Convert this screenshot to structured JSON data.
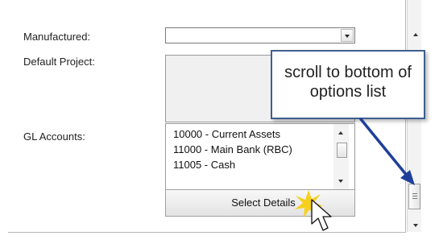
{
  "form": {
    "manufactured_label": "Manufactured:",
    "manufactured_value": "",
    "default_project_label": "Default Project:",
    "gl_accounts_label": "GL Accounts:",
    "gl_accounts": [
      "10000 - Current Assets",
      "11000 - Main Bank (RBC)",
      "11005 - Cash"
    ],
    "select_details_label": "Select Details"
  },
  "callout": {
    "line1": "scroll to bottom of",
    "line2": "options list"
  },
  "colors": {
    "callout_border": "#3f5f8e",
    "arrow": "#1f3f9a",
    "sparkle": "#f6d01c"
  }
}
